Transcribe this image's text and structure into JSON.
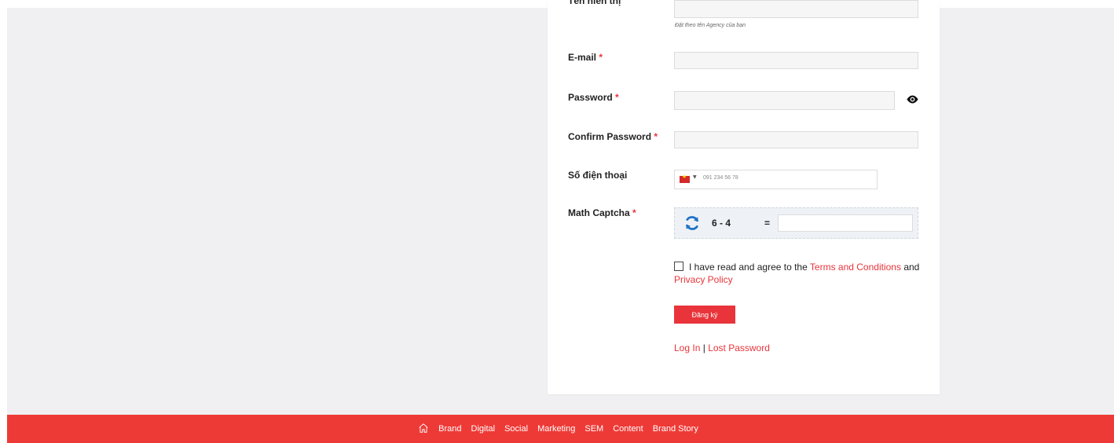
{
  "form": {
    "display_name": {
      "label": "Tên hiển thị",
      "hint": "Đặt theo tên Agency của bạn"
    },
    "email": {
      "label": "E-mail",
      "required_mark": "*"
    },
    "password": {
      "label": "Password",
      "required_mark": "*"
    },
    "confirm_password": {
      "label": "Confirm Password",
      "required_mark": "*"
    },
    "phone": {
      "label": "Số điện thoại",
      "placeholder": "091 234 56 78",
      "country_flag": "vn-flag-icon"
    },
    "captcha": {
      "label": "Math Captcha",
      "required_mark": "*",
      "question": "6 - 4",
      "equals": "="
    },
    "terms": {
      "prefix": "I have read and agree to the",
      "terms_link": "Terms and Conditions",
      "and": "and",
      "privacy_link": "Privacy Policy"
    },
    "submit_label": "Đăng ký",
    "login_link": "Log In",
    "separator": "|",
    "lost_password_link": "Lost Password"
  },
  "footer": {
    "items": [
      "Brand",
      "Digital",
      "Social",
      "Marketing",
      "SEM",
      "Content",
      "Brand Story"
    ]
  },
  "colors": {
    "accent": "#e8343a",
    "footer_bg": "#ee3a36",
    "page_bg": "#f0f0f2"
  }
}
